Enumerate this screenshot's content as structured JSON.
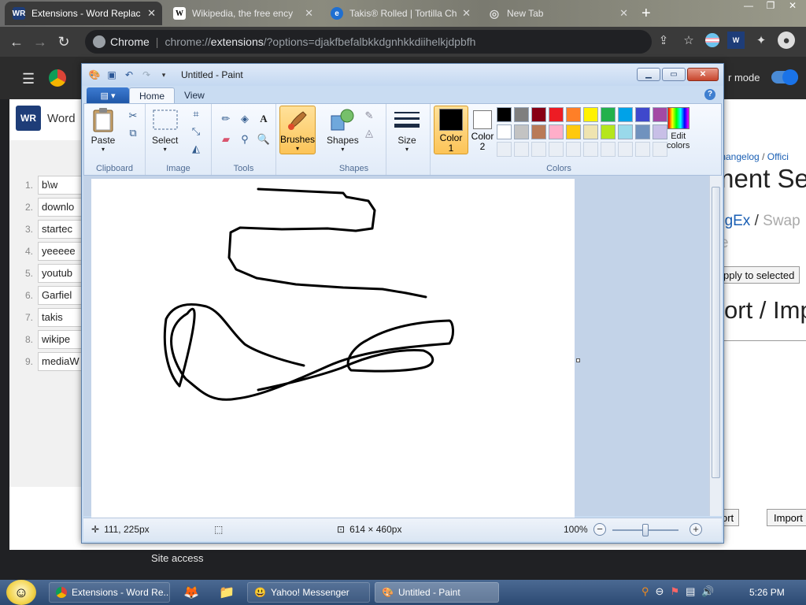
{
  "browser": {
    "tabs": [
      {
        "title": "Extensions - Word Replac",
        "fav": "WR"
      },
      {
        "title": "Wikipedia, the free ency",
        "fav": "W"
      },
      {
        "title": "Takis® Rolled | Tortilla Ch",
        "fav": "e"
      },
      {
        "title": "New Tab",
        "fav": "◎"
      }
    ],
    "omnibox": {
      "site": "Chrome",
      "sep": "|",
      "url_scheme": "chrome://",
      "url_host": "extensions",
      "url_rest": "/?options=djakfbefalbkkdgnhkkdiihelkjdpbfh"
    }
  },
  "ext_page": {
    "dev_mode_label": "r mode",
    "site_access": "Site access",
    "options": {
      "logo_text": "WR",
      "title": "Word",
      "rules": [
        {
          "num": "1.",
          "value": "b\\w"
        },
        {
          "num": "2.",
          "value": "downlo"
        },
        {
          "num": "3.",
          "value": "startec"
        },
        {
          "num": "4.",
          "value": "yeeeee"
        },
        {
          "num": "5.",
          "value": "youtub"
        },
        {
          "num": "6.",
          "value": "Garfiel"
        },
        {
          "num": "7.",
          "value": "takis"
        },
        {
          "num": "8.",
          "value": "wikipe"
        },
        {
          "num": "9.",
          "value": "mediaW"
        }
      ],
      "links": {
        "a": "/ ",
        "changelog": "Changelog",
        "b": " / ",
        "official": "Offici"
      },
      "h1": "ment Se",
      "regex": {
        "regex": "egEx",
        "sep": " / ",
        "swap": "Swap"
      },
      "e_text": "e",
      "apply_label": "pply to selected",
      "h2": "ort / Imp",
      "port_label": "ort",
      "import_label": "Import"
    }
  },
  "paint": {
    "title": "Untitled - Paint",
    "tabs": {
      "home": "Home",
      "view": "View"
    },
    "groups": {
      "clipboard": {
        "label": "Clipboard",
        "paste": "Paste"
      },
      "image": {
        "label": "Image",
        "select": "Select"
      },
      "tools": {
        "label": "Tools"
      },
      "brushes": "Brushes",
      "shapes": {
        "label": "Shapes",
        "btn": "Shapes"
      },
      "size": "Size",
      "colors": {
        "label": "Colors",
        "color1": "Color\n1",
        "color2": "Color\n2",
        "edit": "Edit\ncolors"
      }
    },
    "colors": {
      "color1": "#000000",
      "color2": "#ffffff",
      "row1": [
        "#000000",
        "#7f7f7f",
        "#880015",
        "#ed1c24",
        "#ff7f27",
        "#fff200",
        "#22b14c",
        "#00a2e8",
        "#3f48cc",
        "#a349a4"
      ],
      "row2": [
        "#ffffff",
        "#c3c3c3",
        "#b97a57",
        "#ffaec9",
        "#ffc90e",
        "#efe4b0",
        "#b5e61d",
        "#99d9ea",
        "#7092be",
        "#c8bfe7"
      ]
    },
    "status": {
      "cursor": "111, 225px",
      "canvas_size": "614 × 460px",
      "zoom": "100%",
      "zoom_level": 0.5
    }
  },
  "taskbar": {
    "items": [
      {
        "label": "Extensions - Word Re..."
      },
      {
        "label": "Yahoo! Messenger"
      },
      {
        "label": "Untitled - Paint"
      }
    ],
    "clock": "5:26 PM"
  }
}
